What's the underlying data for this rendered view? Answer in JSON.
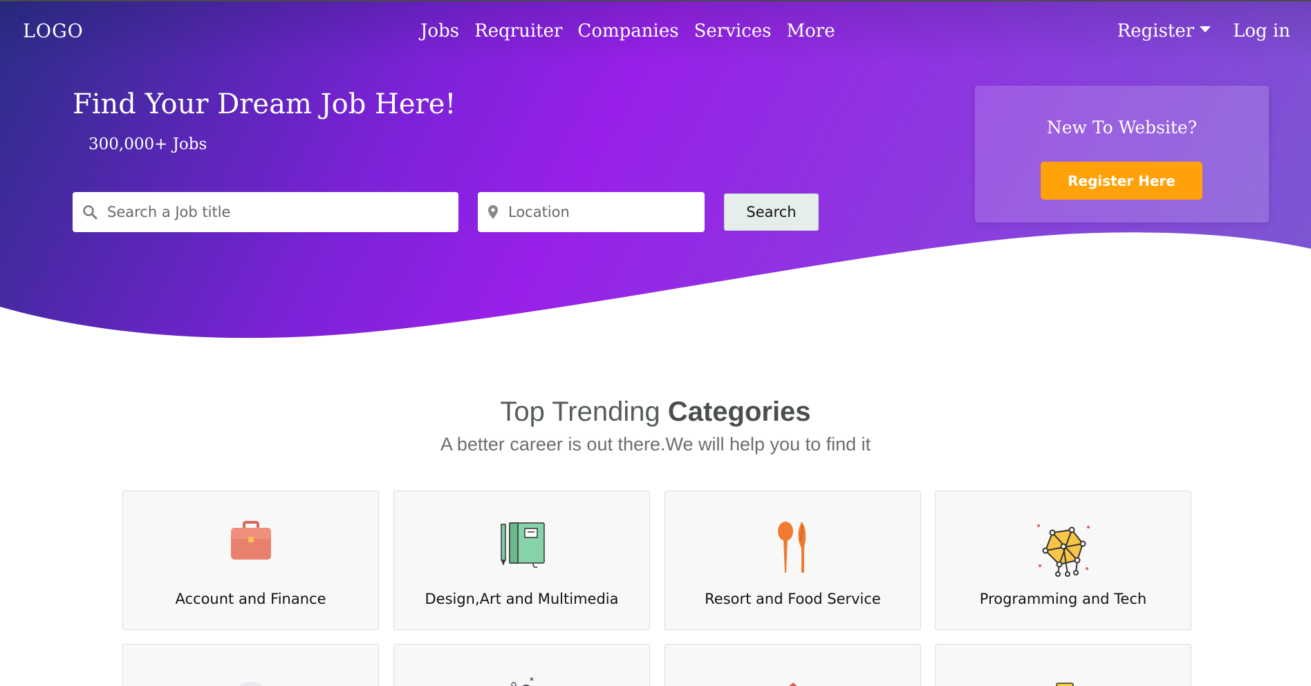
{
  "header": {
    "logo": "LOGO",
    "nav": [
      "Jobs",
      "Reqruiter",
      "Companies",
      "Services",
      "More"
    ],
    "register": "Register",
    "login": "Log in"
  },
  "hero": {
    "headline": "Find Your Dream Job Here!",
    "jobs_count": "300,000+ Jobs",
    "search_placeholder": "Search a Job title",
    "location_placeholder": "Location",
    "search_button": "Search"
  },
  "register_card": {
    "title": "New To Website?",
    "button": "Register Here"
  },
  "categories": {
    "title_light": "Top Trending ",
    "title_bold": "Categories",
    "subtitle": "A better career is out there.We will help you to find it",
    "items": [
      {
        "label": "Account and Finance",
        "icon": "briefcase-icon"
      },
      {
        "label": "Design,Art and Multimedia",
        "icon": "notebook-icon"
      },
      {
        "label": "Resort and Food Service",
        "icon": "cutlery-icon"
      },
      {
        "label": "Programming and Tech",
        "icon": "network-icon"
      }
    ]
  },
  "colors": {
    "hero_start": "#2a2d86",
    "hero_mid": "#9820e8",
    "hero_end": "#7a5ad0",
    "accent_orange": "#ffa20a",
    "card_bg": "#f8f8f8"
  }
}
